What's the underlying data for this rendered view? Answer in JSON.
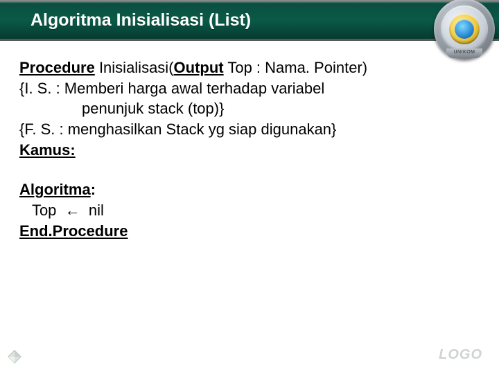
{
  "header": {
    "title": "Algoritma Inisialisasi (List)"
  },
  "logo": {
    "under_label": "UNIKOM"
  },
  "body": {
    "proc_kw": "Procedure",
    "proc_name": " Inisialisasi(",
    "output_kw": "Output",
    "proc_tail": "  Top : Nama. Pointer)",
    "is_line": "{I. S. : Memberi harga awal terhadap variabel",
    "is_cont": "penunjuk stack (top)}",
    "fs_line": "{F. S. : menghasilkan Stack yg siap digunakan}",
    "kamus": "Kamus:",
    "algoritma": "Algoritma",
    "alg_colon": ":",
    "assign": "   Top  ←  nil",
    "endproc": "End.Procedure"
  },
  "footer": {
    "watermark": "LOGO"
  }
}
